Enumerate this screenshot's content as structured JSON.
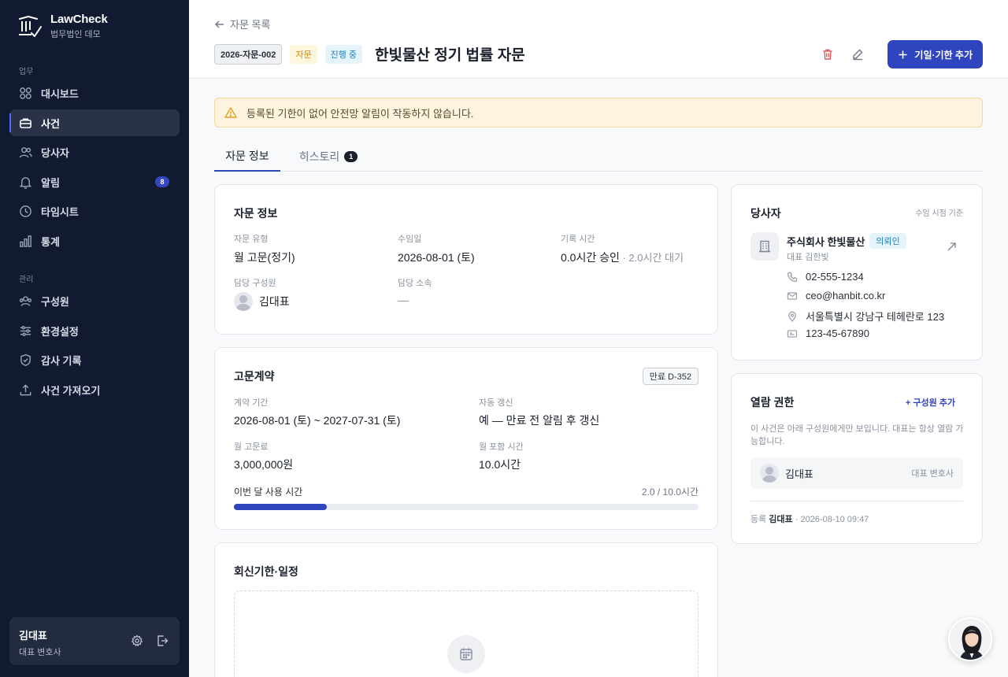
{
  "app": {
    "name": "LawCheck",
    "subtitle": "법무법인 데모"
  },
  "sidebar": {
    "section_work": "업무",
    "section_admin": "관리",
    "items_work": [
      {
        "label": "대시보드",
        "icon": "grid-icon"
      },
      {
        "label": "사건",
        "icon": "briefcase-icon",
        "active": true
      },
      {
        "label": "당사자",
        "icon": "users-icon"
      },
      {
        "label": "알림",
        "icon": "bell-icon",
        "badge": "8"
      },
      {
        "label": "타임시트",
        "icon": "clock-icon"
      },
      {
        "label": "통계",
        "icon": "bar-chart-icon"
      }
    ],
    "items_admin": [
      {
        "label": "구성원",
        "icon": "team-icon"
      },
      {
        "label": "환경설정",
        "icon": "sliders-icon"
      },
      {
        "label": "감사 기록",
        "icon": "shield-icon"
      },
      {
        "label": "사건 가져오기",
        "icon": "upload-icon"
      }
    ],
    "user": {
      "name": "김대표",
      "role": "대표 변호사"
    }
  },
  "header": {
    "back_label": "자문 목록",
    "case_no": "2026-자문-002",
    "type_chip": "자문",
    "status_chip": "진행 중",
    "title": "한빛물산 정기 법률 자문",
    "add_deadline_label": "기일·기한 추가"
  },
  "alert": {
    "text": "등록된 기한이 없어 안전망 알림이 작동하지 않습니다."
  },
  "tabs": [
    {
      "label": "자문 정보",
      "active": true
    },
    {
      "label": "히스토리",
      "count": "1"
    }
  ],
  "advisory_info": {
    "title": "자문 정보",
    "type_label": "자문 유형",
    "type_value": "월 고문(정기)",
    "received_label": "수임일",
    "received_value": "2026-08-01 (토)",
    "hours_label": "기록 시간",
    "hours_approved": "0.0시간 승인",
    "hours_pending": " · 2.0시간 대기",
    "member_label": "담당 구성원",
    "member_value": "김대표",
    "dept_label": "담당 소속",
    "dept_value": "—"
  },
  "retainer": {
    "title": "고문계약",
    "expiry_tag": "만료 D-352",
    "period_label": "계약 기간",
    "period_value": "2026-08-01 (토) ~ 2027-07-31 (토)",
    "renew_label": "자동 갱신",
    "renew_value": "예 — 만료 전 알림 후 갱신",
    "fee_label": "월 고문료",
    "fee_value": "3,000,000원",
    "included_label": "월 포함 시간",
    "included_value": "10.0시간",
    "usage_label": "이번 달 사용 시간",
    "usage_value": "2.0 / 10.0시간",
    "usage_used": 2.0,
    "usage_total": 10.0
  },
  "schedule": {
    "title": "회신기한·일정"
  },
  "party": {
    "title": "당사자",
    "basis": "수임 시점 기준",
    "name": "주식회사 한빛물산",
    "badge": "의뢰인",
    "rep": "대표 김한빛",
    "phone": "02-555-1234",
    "email": "ceo@hanbit.co.kr",
    "address": "서울특별시 강남구 테헤란로 123",
    "biz_no": "123-45-67890"
  },
  "access": {
    "title": "열람 권한",
    "add_member": "+ 구성원 추가",
    "desc": "이 사건은 아래 구성원에게만 보입니다. 대표는 항상 열람 가능합니다.",
    "member_name": "김대표",
    "member_role": "대표 변호사",
    "registered_prefix": "등록 ",
    "registered_by": "김대표",
    "registered_at": " · 2026-08-10 09:47"
  },
  "colors": {
    "sidebar_bg": "#111a30",
    "accent": "#2f45c0",
    "danger": "#e0585b",
    "warning_bg": "#fdf3de"
  }
}
